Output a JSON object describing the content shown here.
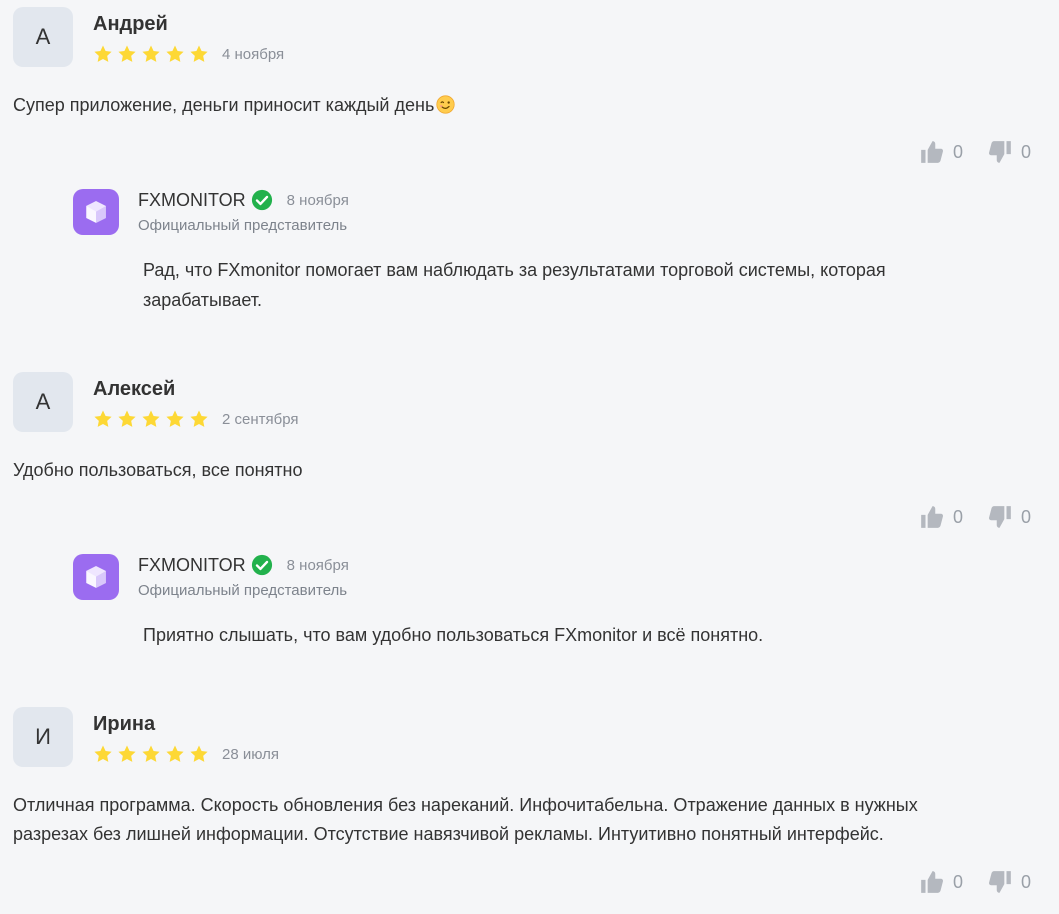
{
  "reviews": [
    {
      "initial": "А",
      "author": "Андрей",
      "rating": 5,
      "date": "4 ноября",
      "text": "Супер приложение, деньги приносит каждый день",
      "emoji": "winking-face-icon",
      "likes": "0",
      "dislikes": "0",
      "reply": {
        "name": "FXMONITOR",
        "date": "8 ноября",
        "role": "Официальный представитель",
        "text": "Рад, что FXmonitor помогает вам наблюдать за результатами торговой системы, которая зарабатывает."
      }
    },
    {
      "initial": "А",
      "author": "Алексей",
      "rating": 5,
      "date": "2 сентября",
      "text": "Удобно пользоваться, все понятно",
      "likes": "0",
      "dislikes": "0",
      "reply": {
        "name": "FXMONITOR",
        "date": "8 ноября",
        "role": "Официальный представитель",
        "text": "Приятно слышать, что вам удобно пользоваться FXmonitor и всё понятно."
      }
    },
    {
      "initial": "И",
      "author": "Ирина",
      "rating": 5,
      "date": "28 июля",
      "text": "Отличная программа. Скорость обновления без нареканий. Инфочитабельна. Отражение данных в нужных разрезах без лишней информации. Отсутствие навязчивой рекламы. Интуитивно понятный интерфейс.",
      "likes": "0",
      "dislikes": "0"
    }
  ],
  "colors": {
    "background": "#f5f6f8",
    "star": "#fdd835",
    "avatar": "#e2e7ee",
    "brand_avatar": "#9b6cf0",
    "verified": "#22b14c",
    "muted": "#8a8f98",
    "vote_icon": "#b4b8bf"
  }
}
